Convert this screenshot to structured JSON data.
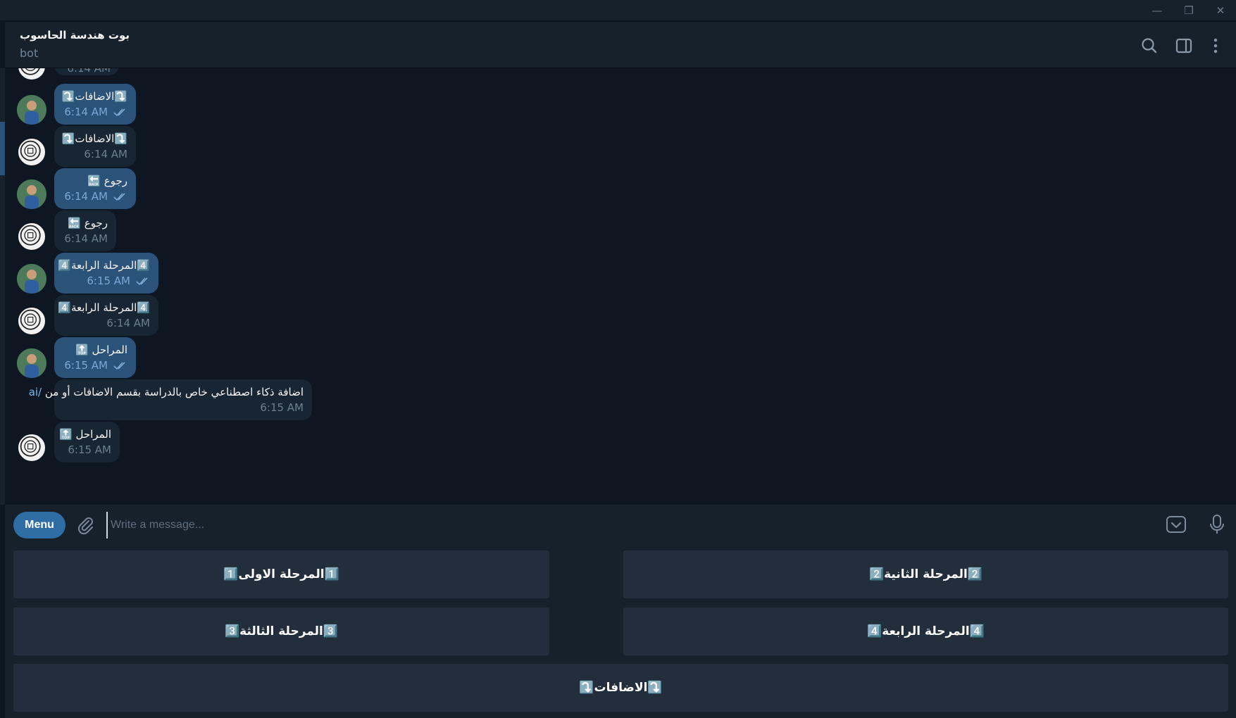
{
  "window": {
    "minimize": "—",
    "restore": "❐",
    "close": "✕"
  },
  "header": {
    "title": "بوت هندسة الحاسوب",
    "subtitle": "bot"
  },
  "messages": [
    {
      "sender": "user",
      "text": "⤵️الاضافات⤵️",
      "time": "6:14 AM"
    },
    {
      "sender": "bot",
      "text": "⤵️الاضافات⤵️",
      "time": "6:14 AM"
    },
    {
      "sender": "user",
      "text": "رجوع 🔙",
      "time": "6:14 AM"
    },
    {
      "sender": "bot",
      "text": "رجوع 🔙",
      "time": "6:14 AM"
    },
    {
      "sender": "user",
      "text": "4️⃣المرحلة الرابعة4️⃣",
      "time": "6:15 AM"
    },
    {
      "sender": "bot",
      "text": "4️⃣المرحلة الرابعة4️⃣",
      "time": "6:14 AM"
    },
    {
      "sender": "user",
      "text": "المراحل 🔝",
      "time": "6:15 AM"
    },
    {
      "sender": "bot",
      "text": "اضافة ذكاء اصطناعي خاص بالدراسة بقسم الاضافات أو من",
      "link": "/ai",
      "time": "6:15 AM"
    },
    {
      "sender": "bot",
      "text": "المراحل 🔝",
      "time": "6:15 AM"
    }
  ],
  "partial_top_time": "6:14 AM",
  "composer": {
    "menu_label": "Menu",
    "placeholder": "Write a message..."
  },
  "keyboard": {
    "buttons": [
      "1️⃣المرحلة الاولى1️⃣",
      "2️⃣المرحلة الثانية2️⃣",
      "3️⃣المرحلة الثالثة3️⃣",
      "4️⃣المرحلة الرابعة4️⃣",
      "⤵️الاضافات⤵️"
    ]
  },
  "colors": {
    "background": "#0e1621",
    "panel": "#17212b",
    "outgoing_bubble": "#2b5278",
    "incoming_bubble": "#182533",
    "accent": "#2f6ea5"
  }
}
